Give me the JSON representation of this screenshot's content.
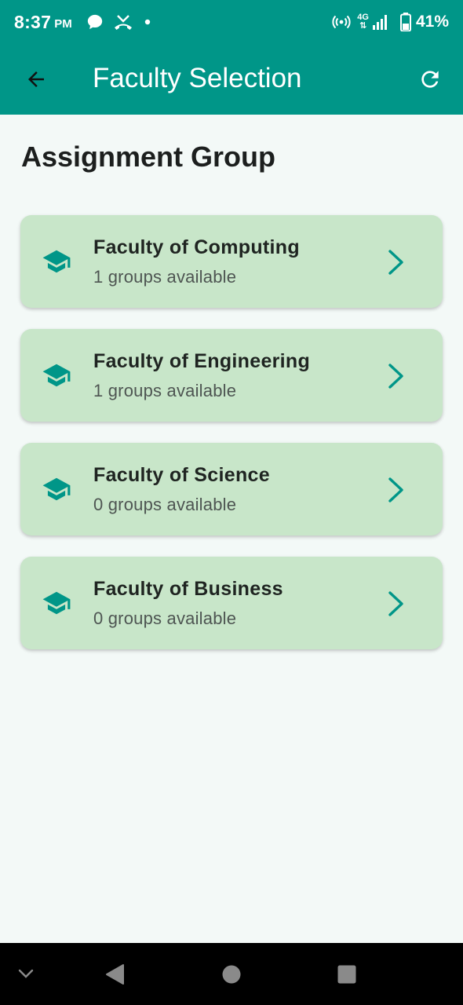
{
  "status_bar": {
    "time": "8:37",
    "ampm": "PM",
    "network": "4G",
    "battery": "41%"
  },
  "app_bar": {
    "title": "Faculty Selection",
    "back_icon": "arrow-back-icon",
    "refresh_icon": "refresh-icon"
  },
  "page": {
    "heading": "Assignment Group"
  },
  "faculties": [
    {
      "name": "Faculty of Computing",
      "groups": "1 groups available"
    },
    {
      "name": "Faculty of Engineering",
      "groups": "1 groups available"
    },
    {
      "name": "Faculty of Science",
      "groups": "0 groups available"
    },
    {
      "name": "Faculty of Business",
      "groups": "0 groups available"
    }
  ],
  "colors": {
    "primary": "#009688",
    "card": "#c8e6c9",
    "background": "#f3f9f7",
    "icon_accent": "#009688"
  }
}
